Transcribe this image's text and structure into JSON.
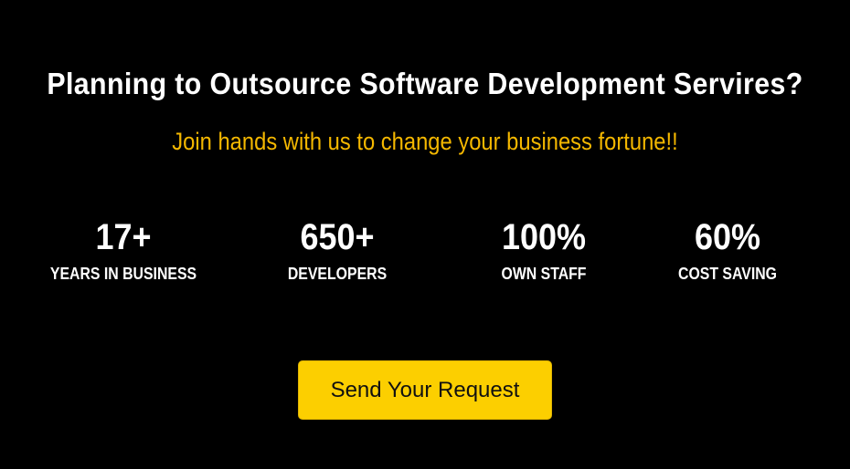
{
  "banner": {
    "headline": "Planning to Outsource Software Development Servires?",
    "subheadline": "Join hands with us to change your business fortune!!",
    "stats": [
      {
        "value": "17+",
        "label": "YEARS IN BUSINESS"
      },
      {
        "value": "650+",
        "label": "DEVELOPERS"
      },
      {
        "value": "100%",
        "label": "OWN STAFF"
      },
      {
        "value": "60%",
        "label": "COST SAVING"
      }
    ],
    "cta_label": "Send Your Request"
  },
  "colors": {
    "background": "#000000",
    "accent_text": "#f5b800",
    "button_bg": "#fccf00",
    "primary_text": "#ffffff"
  }
}
